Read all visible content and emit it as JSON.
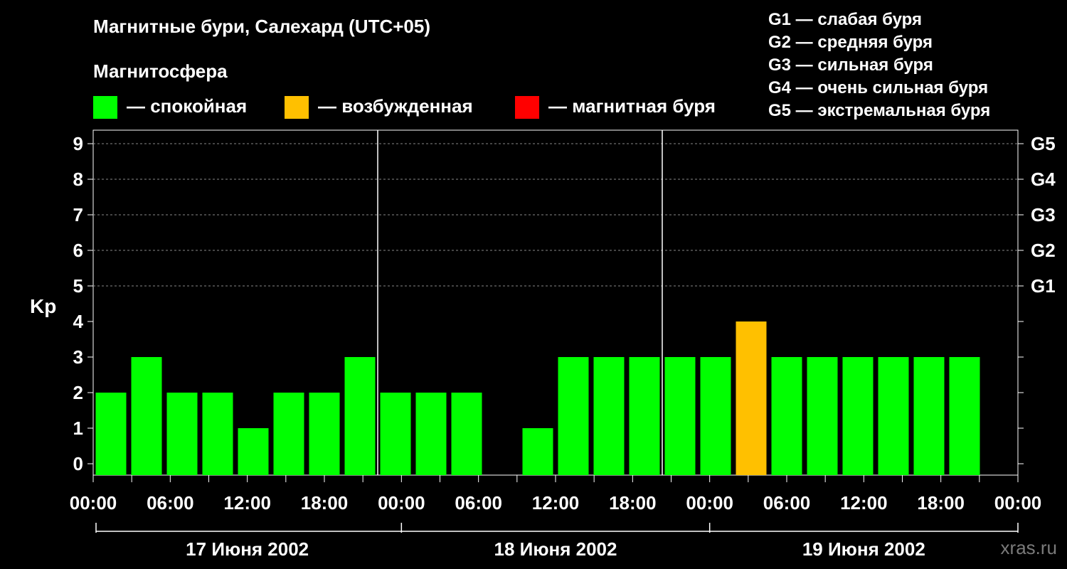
{
  "chart_data": {
    "type": "bar",
    "title": "Магнитные бури, Салехард (UTC+05)",
    "subtitle": "Магнитосфера",
    "ylabel": "Kp",
    "ylim": [
      0,
      9
    ],
    "y_ticks": [
      "0",
      "1",
      "2",
      "3",
      "4",
      "5",
      "6",
      "7",
      "8",
      "9"
    ],
    "g_scale": [
      {
        "kp": 5,
        "label": "G1"
      },
      {
        "kp": 6,
        "label": "G2"
      },
      {
        "kp": 7,
        "label": "G3"
      },
      {
        "kp": 8,
        "label": "G4"
      },
      {
        "kp": 9,
        "label": "G5"
      }
    ],
    "x_tick_labels": [
      "00:00",
      "06:00",
      "12:00",
      "18:00",
      "00:00",
      "06:00",
      "12:00",
      "18:00",
      "00:00",
      "06:00",
      "12:00",
      "18:00",
      "00:00"
    ],
    "days": [
      "17 Июня 2002",
      "18 Июня 2002",
      "19 Июня 2002"
    ],
    "interval_hours": 3,
    "values": [
      2,
      3,
      2,
      2,
      1,
      2,
      2,
      3,
      2,
      2,
      2,
      0,
      1,
      3,
      3,
      3,
      3,
      3,
      4,
      3,
      3,
      3,
      3,
      3,
      3
    ],
    "colors": {
      "quiet": "#00ff00",
      "active": "#ffc000",
      "storm": "#ff0000"
    },
    "legend": [
      {
        "color": "#00ff00",
        "label": "— спокойная"
      },
      {
        "color": "#ffc000",
        "label": "— возбужденная"
      },
      {
        "color": "#ff0000",
        "label": "— магнитная буря"
      }
    ],
    "g_legend": [
      "G1 — слабая буря",
      "G2 — средняя буря",
      "G3 — сильная буря",
      "G4 — очень сильная буря",
      "G5 — экстремальная буря"
    ],
    "grid": true
  },
  "watermark": "xras.ru"
}
